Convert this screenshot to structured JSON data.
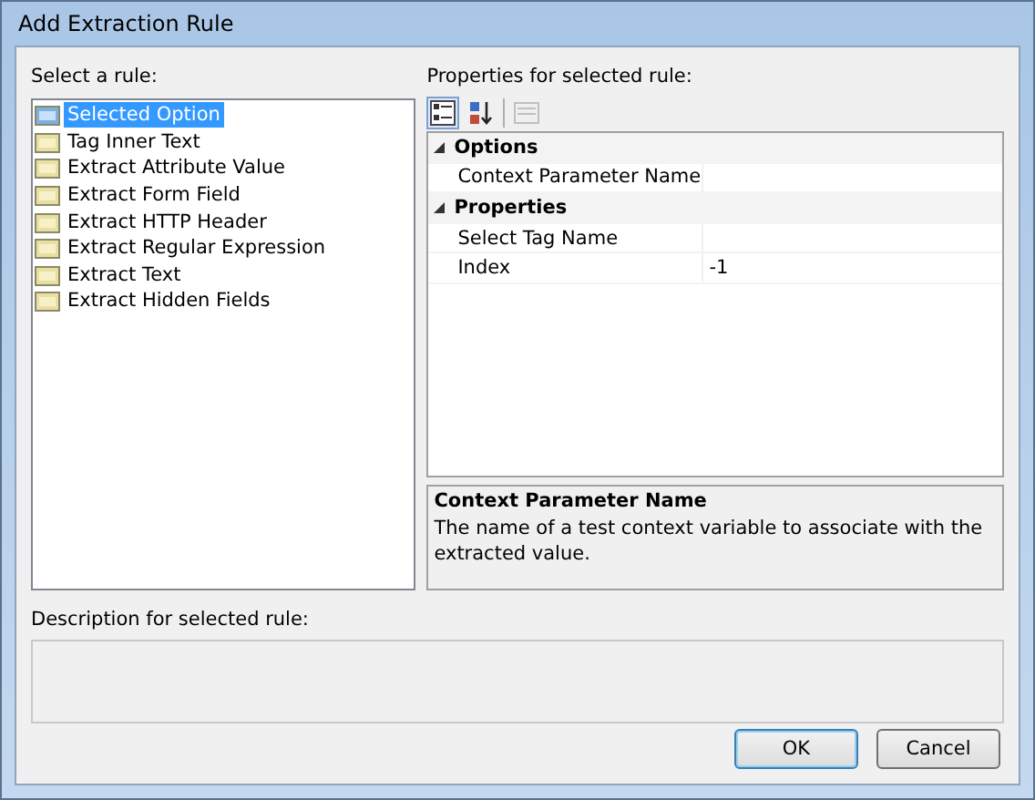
{
  "window": {
    "title": "Add Extraction Rule"
  },
  "rules": {
    "label": "Select a rule:",
    "items": [
      {
        "label": "Selected Option",
        "selected": true
      },
      {
        "label": "Tag Inner Text",
        "selected": false
      },
      {
        "label": "Extract Attribute Value",
        "selected": false
      },
      {
        "label": "Extract Form Field",
        "selected": false
      },
      {
        "label": "Extract HTTP Header",
        "selected": false
      },
      {
        "label": "Extract Regular Expression",
        "selected": false
      },
      {
        "label": "Extract Text",
        "selected": false
      },
      {
        "label": "Extract Hidden Fields",
        "selected": false
      }
    ]
  },
  "properties": {
    "label": "Properties for selected rule:",
    "toolbar": [
      {
        "kind": "categorized",
        "selected": true,
        "disabled": false
      },
      {
        "kind": "alphabetical",
        "selected": false,
        "disabled": false
      },
      {
        "kind": "pages",
        "selected": false,
        "disabled": true
      }
    ],
    "categories": [
      {
        "name": "Options",
        "expanded": true,
        "children": [
          {
            "name": "Context Parameter Name"
          }
        ]
      },
      {
        "name": "Properties",
        "expanded": true,
        "children": [
          {
            "name": "Select Tag Name"
          },
          {
            "name": "Index",
            "value": "-1"
          }
        ]
      }
    ],
    "help": {
      "title": "Context Parameter Name",
      "text": "The name of a test context variable to associate with the extracted value."
    }
  },
  "description": {
    "label": "Description for selected rule:"
  },
  "buttons": [
    {
      "label": "OK",
      "default": true
    },
    {
      "label": "Cancel",
      "default": false
    }
  ]
}
